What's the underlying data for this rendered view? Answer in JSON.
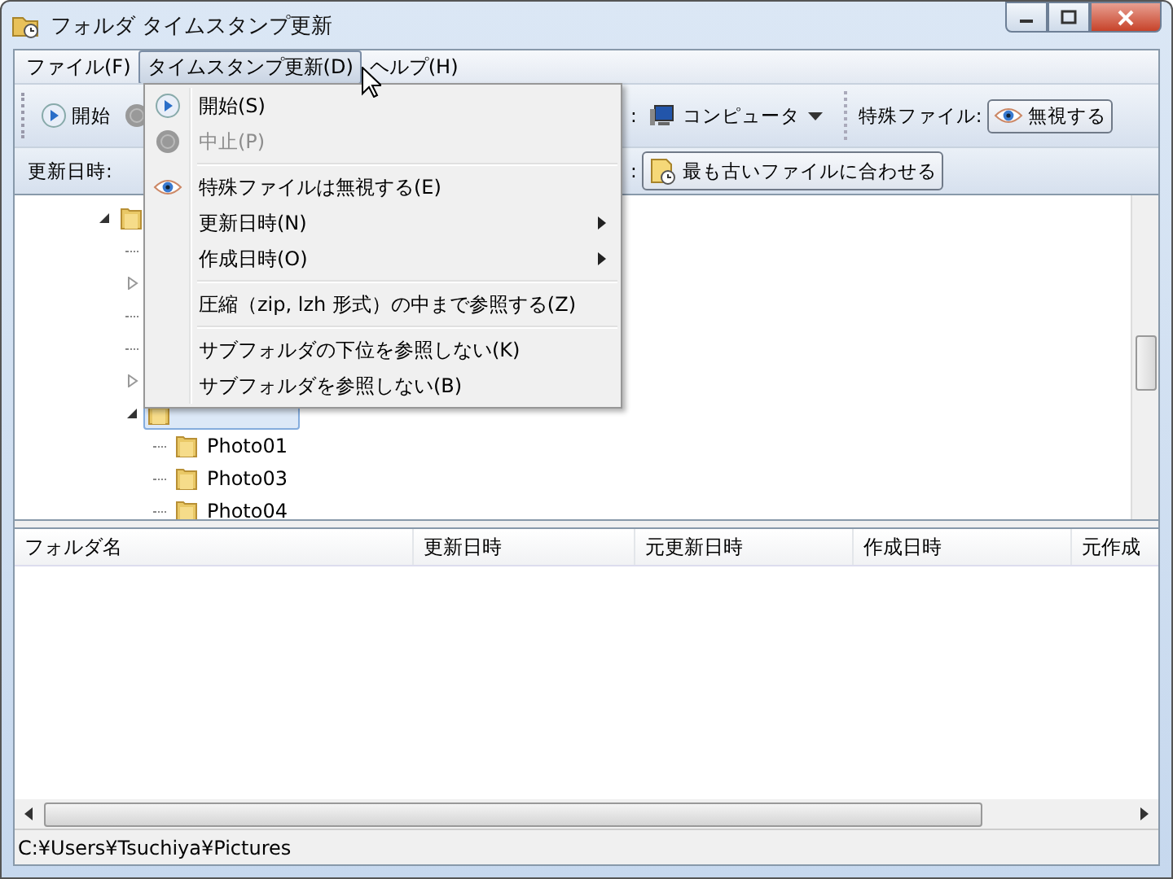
{
  "window": {
    "title": "フォルダ タイムスタンプ更新"
  },
  "menu_bar": [
    {
      "label": "ファイル(F)",
      "selected": false
    },
    {
      "label": "タイムスタンプ更新(D)",
      "selected": true
    },
    {
      "label": "ヘルプ(H)",
      "selected": false
    }
  ],
  "dropdown": [
    {
      "kind": "item",
      "label": "開始(S)",
      "disabled": false,
      "submenu": false
    },
    {
      "kind": "item",
      "label": "中止(P)",
      "disabled": true,
      "submenu": false
    },
    {
      "kind": "separator"
    },
    {
      "kind": "item",
      "label": "特殊ファイルは無視する(E)",
      "disabled": false,
      "submenu": false
    },
    {
      "kind": "item",
      "label": "更新日時(N)",
      "disabled": false,
      "submenu": true
    },
    {
      "kind": "item",
      "label": "作成日時(O)",
      "disabled": false,
      "submenu": true
    },
    {
      "kind": "separator"
    },
    {
      "kind": "item",
      "label": "圧縮（zip, lzh 形式）の中まで参照する(Z)",
      "disabled": false,
      "submenu": false
    },
    {
      "kind": "separator"
    },
    {
      "kind": "item",
      "label": "サブフォルダの下位を参照しない(K)",
      "disabled": false,
      "submenu": false
    },
    {
      "kind": "item",
      "label": "サブフォルダを参照しない(B)",
      "disabled": false,
      "submenu": false
    }
  ],
  "toolbar": {
    "start_button": "開始",
    "location_label": ":",
    "location": "コンピュータ",
    "special_files_label": "特殊ファイル:",
    "special_files_button": "無視する"
  },
  "toolbar_2": {
    "modified_label": "更新日時:",
    "created_label": ":",
    "created_button": "最も古いファイルに合わせる"
  },
  "tree": [
    {
      "kind": "branch",
      "expanded": true,
      "children": [
        {
          "kind": "leaf"
        },
        {
          "kind": "branch",
          "expanded": false
        },
        {
          "kind": "leaf"
        },
        {
          "kind": "leaf"
        },
        {
          "kind": "branch",
          "expanded": false
        },
        {
          "kind": "branch",
          "expanded": true,
          "selected": true,
          "children": [
            {
              "kind": "leaf",
              "label": "Photo01"
            },
            {
              "kind": "leaf",
              "label": "Photo03"
            },
            {
              "kind": "leaf",
              "label": "Photo04"
            }
          ]
        }
      ]
    }
  ],
  "list": {
    "columns": [
      "フォルダ名",
      "更新日時",
      "元更新日時",
      "作成日時",
      "元作成"
    ]
  },
  "status_bar": "C:¥Users¥Tsuchiya¥Pictures"
}
